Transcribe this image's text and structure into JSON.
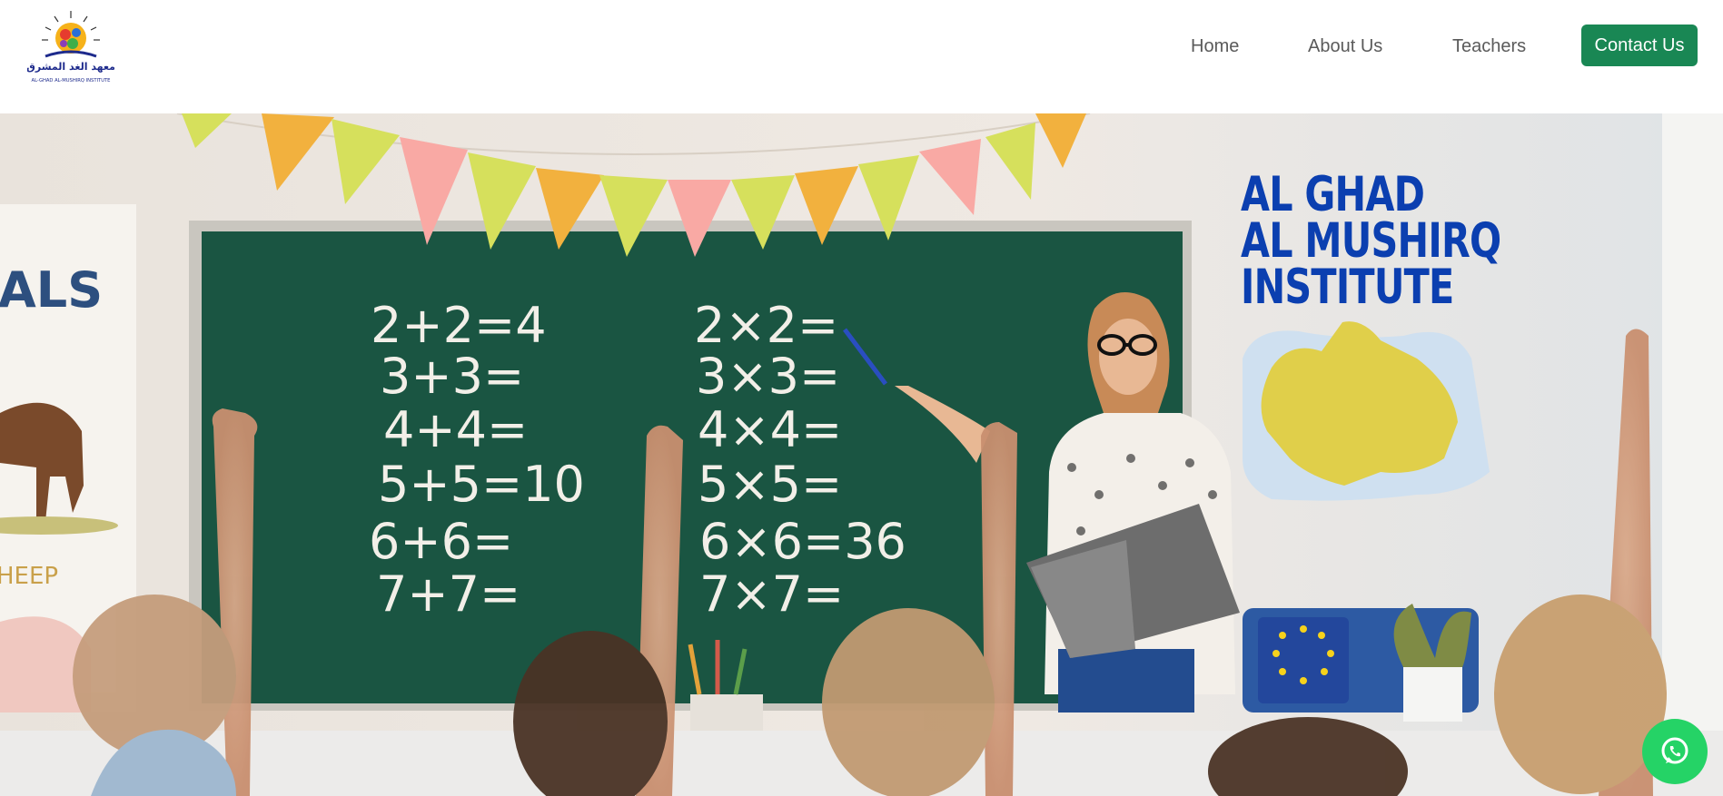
{
  "brand": {
    "logo_text": "AL-GHAD AL-MUSHIRQ INSTITUTE",
    "logo_arabic": "معهد الغد المشرق"
  },
  "nav": {
    "items": [
      {
        "label": "Home"
      },
      {
        "label": "About Us"
      },
      {
        "label": "Teachers"
      }
    ],
    "contact_label": "Contact Us"
  },
  "hero": {
    "title_line1": "AL GHAD",
    "title_line2": "AL MUSHIRQ",
    "title_line3": "INSTITUTE",
    "poster_left_text": "ALS",
    "poster_left_caption": "HEEP",
    "board_left": [
      "2+2=4",
      "3+3=",
      "4+4=",
      "5+5=10",
      "6+6=",
      "7+7="
    ],
    "board_right": [
      "2×2=",
      "3×3=",
      "4×4=",
      "5×5=",
      "6×6=36",
      "7×7="
    ]
  },
  "colors": {
    "brand_blue": "#0b3fb0",
    "contact_green": "#198754",
    "whatsapp_green": "#25d366",
    "chalkboard": "#1c5a46"
  },
  "icons": {
    "whatsapp": "whatsapp-icon",
    "logo": "institute-logo"
  }
}
